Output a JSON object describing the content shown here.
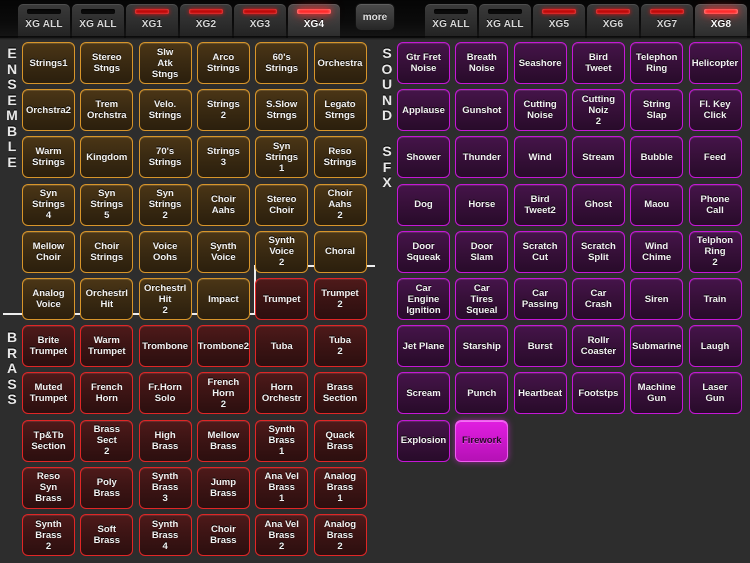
{
  "tabbar": {
    "more_label": "more",
    "left_tabs": [
      {
        "label": "XG ALL",
        "led": "off",
        "active": false
      },
      {
        "label": "XG ALL",
        "led": "off",
        "active": false
      },
      {
        "label": "XG1",
        "led": "on",
        "active": false
      },
      {
        "label": "XG2",
        "led": "on",
        "active": false
      },
      {
        "label": "XG3",
        "led": "on",
        "active": false
      },
      {
        "label": "XG4",
        "led": "on",
        "active": true
      }
    ],
    "right_tabs": [
      {
        "label": "XG ALL",
        "led": "off",
        "active": false
      },
      {
        "label": "XG ALL",
        "led": "off",
        "active": false
      },
      {
        "label": "XG5",
        "led": "on",
        "active": false
      },
      {
        "label": "XG6",
        "led": "on",
        "active": false
      },
      {
        "label": "XG7",
        "led": "on",
        "active": false
      },
      {
        "label": "XG8",
        "led": "on",
        "active": true
      }
    ]
  },
  "colors": {
    "ensemble_border": "#d8952a",
    "brass_border": "#e02626",
    "sfx_border": "#c517d6",
    "selected_fill": "#cc17cc",
    "led_active": "#ff1c1c",
    "background": "#2d2d2d"
  },
  "left_panel": {
    "sections": [
      {
        "name": "ENSEMBLE",
        "letters": [
          "E",
          "N",
          "S",
          "E",
          "M",
          "B",
          "L",
          "E"
        ]
      },
      {
        "name": "BRASS",
        "letters": [
          "B",
          "R",
          "A",
          "S",
          "S"
        ]
      }
    ],
    "buttons": [
      {
        "label": "Strings1",
        "kind": "ens",
        "row": 0,
        "col": 0
      },
      {
        "label": "Stereo\nStngs",
        "kind": "ens",
        "row": 0,
        "col": 1
      },
      {
        "label": "Slw\nAtk\nStngs",
        "kind": "ens",
        "row": 0,
        "col": 2
      },
      {
        "label": "Arco\nStrings",
        "kind": "ens",
        "row": 0,
        "col": 3
      },
      {
        "label": "60's\nStrings",
        "kind": "ens",
        "row": 0,
        "col": 4
      },
      {
        "label": "Orchestra",
        "kind": "ens",
        "row": 0,
        "col": 5
      },
      {
        "label": "Orchstra2",
        "kind": "ens",
        "row": 1,
        "col": 0
      },
      {
        "label": "Trem\nOrchstra",
        "kind": "ens",
        "row": 1,
        "col": 1
      },
      {
        "label": "Velo.\nStrings",
        "kind": "ens",
        "row": 1,
        "col": 2
      },
      {
        "label": "Strings\n2",
        "kind": "ens",
        "row": 1,
        "col": 3
      },
      {
        "label": "S.Slow\nStrngs",
        "kind": "ens",
        "row": 1,
        "col": 4
      },
      {
        "label": "Legato\nStrngs",
        "kind": "ens",
        "row": 1,
        "col": 5
      },
      {
        "label": "Warm\nStrings",
        "kind": "ens",
        "row": 2,
        "col": 0
      },
      {
        "label": "Kingdom",
        "kind": "ens",
        "row": 2,
        "col": 1
      },
      {
        "label": "70's\nStrings",
        "kind": "ens",
        "row": 2,
        "col": 2
      },
      {
        "label": "Strings\n3",
        "kind": "ens",
        "row": 2,
        "col": 3
      },
      {
        "label": "Syn\nStrings\n1",
        "kind": "ens",
        "row": 2,
        "col": 4
      },
      {
        "label": "Reso\nStrings",
        "kind": "ens",
        "row": 2,
        "col": 5
      },
      {
        "label": "Syn\nStrings\n4",
        "kind": "ens",
        "row": 3,
        "col": 0
      },
      {
        "label": "Syn\nStrings\n5",
        "kind": "ens",
        "row": 3,
        "col": 1
      },
      {
        "label": "Syn\nStrings\n2",
        "kind": "ens",
        "row": 3,
        "col": 2
      },
      {
        "label": "Choir\nAahs",
        "kind": "ens",
        "row": 3,
        "col": 3
      },
      {
        "label": "Stereo\nChoir",
        "kind": "ens",
        "row": 3,
        "col": 4
      },
      {
        "label": "Choir\nAahs\n2",
        "kind": "ens",
        "row": 3,
        "col": 5
      },
      {
        "label": "Mellow\nChoir",
        "kind": "ens",
        "row": 4,
        "col": 0
      },
      {
        "label": "Choir\nStrings",
        "kind": "ens",
        "row": 4,
        "col": 1
      },
      {
        "label": "Voice\nOohs",
        "kind": "ens",
        "row": 4,
        "col": 2
      },
      {
        "label": "Synth\nVoice",
        "kind": "ens",
        "row": 4,
        "col": 3
      },
      {
        "label": "Synth\nVoice\n2",
        "kind": "ens",
        "row": 4,
        "col": 4
      },
      {
        "label": "Choral",
        "kind": "ens",
        "row": 4,
        "col": 5
      },
      {
        "label": "Analog\nVoice",
        "kind": "ens",
        "row": 5,
        "col": 0
      },
      {
        "label": "Orchestrl\nHit",
        "kind": "ens",
        "row": 5,
        "col": 1
      },
      {
        "label": "Orchestrl\nHit\n2",
        "kind": "ens",
        "row": 5,
        "col": 2
      },
      {
        "label": "Impact",
        "kind": "ens",
        "row": 5,
        "col": 3
      },
      {
        "label": "Trumpet",
        "kind": "brs",
        "row": 5,
        "col": 4
      },
      {
        "label": "Trumpet\n2",
        "kind": "brs",
        "row": 5,
        "col": 5
      },
      {
        "label": "Brite\nTrumpet",
        "kind": "brs",
        "row": 6,
        "col": 0
      },
      {
        "label": "Warm\nTrumpet",
        "kind": "brs",
        "row": 6,
        "col": 1
      },
      {
        "label": "Trombone",
        "kind": "brs",
        "row": 6,
        "col": 2
      },
      {
        "label": "Trombone2",
        "kind": "brs",
        "row": 6,
        "col": 3
      },
      {
        "label": "Tuba",
        "kind": "brs",
        "row": 6,
        "col": 4
      },
      {
        "label": "Tuba\n2",
        "kind": "brs",
        "row": 6,
        "col": 5
      },
      {
        "label": "Muted\nTrumpet",
        "kind": "brs",
        "row": 7,
        "col": 0
      },
      {
        "label": "French\nHorn",
        "kind": "brs",
        "row": 7,
        "col": 1
      },
      {
        "label": "Fr.Horn\nSolo",
        "kind": "brs",
        "row": 7,
        "col": 2
      },
      {
        "label": "French\nHorn\n2",
        "kind": "brs",
        "row": 7,
        "col": 3
      },
      {
        "label": "Horn\nOrchestr",
        "kind": "brs",
        "row": 7,
        "col": 4
      },
      {
        "label": "Brass\nSection",
        "kind": "brs",
        "row": 7,
        "col": 5
      },
      {
        "label": "Tp&Tb\nSection",
        "kind": "brs",
        "row": 8,
        "col": 0
      },
      {
        "label": "Brass\nSect\n2",
        "kind": "brs",
        "row": 8,
        "col": 1
      },
      {
        "label": "High\nBrass",
        "kind": "brs",
        "row": 8,
        "col": 2
      },
      {
        "label": "Mellow\nBrass",
        "kind": "brs",
        "row": 8,
        "col": 3
      },
      {
        "label": "Synth\nBrass\n1",
        "kind": "brs",
        "row": 8,
        "col": 4
      },
      {
        "label": "Quack\nBrass",
        "kind": "brs",
        "row": 8,
        "col": 5
      },
      {
        "label": "Reso\nSyn\nBrass",
        "kind": "brs",
        "row": 9,
        "col": 0
      },
      {
        "label": "Poly\nBrass",
        "kind": "brs",
        "row": 9,
        "col": 1
      },
      {
        "label": "Synth\nBrass\n3",
        "kind": "brs",
        "row": 9,
        "col": 2
      },
      {
        "label": "Jump\nBrass",
        "kind": "brs",
        "row": 9,
        "col": 3
      },
      {
        "label": "Ana Vel\nBrass\n1",
        "kind": "brs",
        "row": 9,
        "col": 4
      },
      {
        "label": "Analog\nBrass\n1",
        "kind": "brs",
        "row": 9,
        "col": 5
      },
      {
        "label": "Synth\nBrass\n2",
        "kind": "brs",
        "row": 10,
        "col": 0
      },
      {
        "label": "Soft\nBrass",
        "kind": "brs",
        "row": 10,
        "col": 1
      },
      {
        "label": "Synth\nBrass\n4",
        "kind": "brs",
        "row": 10,
        "col": 2
      },
      {
        "label": "Choir\nBrass",
        "kind": "brs",
        "row": 10,
        "col": 3
      },
      {
        "label": "Ana Vel\nBrass\n2",
        "kind": "brs",
        "row": 10,
        "col": 4
      },
      {
        "label": "Analog\nBrass\n2",
        "kind": "brs",
        "row": 10,
        "col": 5
      }
    ]
  },
  "right_panel": {
    "sections": [
      {
        "name": "SOUND",
        "letters": [
          "S",
          "O",
          "U",
          "N",
          "D"
        ]
      },
      {
        "name": "SFX",
        "letters": [
          "S",
          "F",
          "X"
        ]
      }
    ],
    "buttons": [
      {
        "label": "Gtr Fret\nNoise",
        "kind": "sfx",
        "row": 0,
        "col": 0
      },
      {
        "label": "Breath\nNoise",
        "kind": "sfx",
        "row": 0,
        "col": 1
      },
      {
        "label": "Seashore",
        "kind": "sfx",
        "row": 0,
        "col": 2
      },
      {
        "label": "Bird\nTweet",
        "kind": "sfx",
        "row": 0,
        "col": 3
      },
      {
        "label": "Telephon\nRing",
        "kind": "sfx",
        "row": 0,
        "col": 4
      },
      {
        "label": "Helicopter",
        "kind": "sfx",
        "row": 0,
        "col": 5
      },
      {
        "label": "Applause",
        "kind": "sfx",
        "row": 1,
        "col": 0
      },
      {
        "label": "Gunshot",
        "kind": "sfx",
        "row": 1,
        "col": 1
      },
      {
        "label": "Cutting\nNoise",
        "kind": "sfx",
        "row": 1,
        "col": 2
      },
      {
        "label": "Cutting\nNoiz\n2",
        "kind": "sfx",
        "row": 1,
        "col": 3
      },
      {
        "label": "String\nSlap",
        "kind": "sfx",
        "row": 1,
        "col": 4
      },
      {
        "label": "Fl. Key\nClick",
        "kind": "sfx",
        "row": 1,
        "col": 5
      },
      {
        "label": "Shower",
        "kind": "sfx",
        "row": 2,
        "col": 0
      },
      {
        "label": "Thunder",
        "kind": "sfx",
        "row": 2,
        "col": 1
      },
      {
        "label": "Wind",
        "kind": "sfx",
        "row": 2,
        "col": 2
      },
      {
        "label": "Stream",
        "kind": "sfx",
        "row": 2,
        "col": 3
      },
      {
        "label": "Bubble",
        "kind": "sfx",
        "row": 2,
        "col": 4
      },
      {
        "label": "Feed",
        "kind": "sfx",
        "row": 2,
        "col": 5
      },
      {
        "label": "Dog",
        "kind": "sfx",
        "row": 3,
        "col": 0
      },
      {
        "label": "Horse",
        "kind": "sfx",
        "row": 3,
        "col": 1
      },
      {
        "label": "Bird\nTweet2",
        "kind": "sfx",
        "row": 3,
        "col": 2
      },
      {
        "label": "Ghost",
        "kind": "sfx",
        "row": 3,
        "col": 3
      },
      {
        "label": "Maou",
        "kind": "sfx",
        "row": 3,
        "col": 4
      },
      {
        "label": "Phone\nCall",
        "kind": "sfx",
        "row": 3,
        "col": 5
      },
      {
        "label": "Door\nSqueak",
        "kind": "sfx",
        "row": 4,
        "col": 0
      },
      {
        "label": "Door\nSlam",
        "kind": "sfx",
        "row": 4,
        "col": 1
      },
      {
        "label": "Scratch\nCut",
        "kind": "sfx",
        "row": 4,
        "col": 2
      },
      {
        "label": "Scratch\nSplit",
        "kind": "sfx",
        "row": 4,
        "col": 3
      },
      {
        "label": "Wind\nChime",
        "kind": "sfx",
        "row": 4,
        "col": 4
      },
      {
        "label": "Telphon\nRing\n2",
        "kind": "sfx",
        "row": 4,
        "col": 5
      },
      {
        "label": "Car\nEngine\nIgnition",
        "kind": "sfx",
        "row": 5,
        "col": 0
      },
      {
        "label": "Car\nTires\nSqueal",
        "kind": "sfx",
        "row": 5,
        "col": 1
      },
      {
        "label": "Car\nPassing",
        "kind": "sfx",
        "row": 5,
        "col": 2
      },
      {
        "label": "Car\nCrash",
        "kind": "sfx",
        "row": 5,
        "col": 3
      },
      {
        "label": "Siren",
        "kind": "sfx",
        "row": 5,
        "col": 4
      },
      {
        "label": "Train",
        "kind": "sfx",
        "row": 5,
        "col": 5
      },
      {
        "label": "Jet Plane",
        "kind": "sfx",
        "row": 6,
        "col": 0
      },
      {
        "label": "Starship",
        "kind": "sfx",
        "row": 6,
        "col": 1
      },
      {
        "label": "Burst",
        "kind": "sfx",
        "row": 6,
        "col": 2
      },
      {
        "label": "Rollr\nCoaster",
        "kind": "sfx",
        "row": 6,
        "col": 3
      },
      {
        "label": "Submarine",
        "kind": "sfx",
        "row": 6,
        "col": 4
      },
      {
        "label": "Laugh",
        "kind": "sfx",
        "row": 6,
        "col": 5
      },
      {
        "label": "Scream",
        "kind": "sfx",
        "row": 7,
        "col": 0
      },
      {
        "label": "Punch",
        "kind": "sfx",
        "row": 7,
        "col": 1
      },
      {
        "label": "Heartbeat",
        "kind": "sfx",
        "row": 7,
        "col": 2
      },
      {
        "label": "Footstps",
        "kind": "sfx",
        "row": 7,
        "col": 3
      },
      {
        "label": "Machine\nGun",
        "kind": "sfx",
        "row": 7,
        "col": 4
      },
      {
        "label": "Laser\nGun",
        "kind": "sfx",
        "row": 7,
        "col": 5
      },
      {
        "label": "Explosion",
        "kind": "sfx",
        "row": 8,
        "col": 0
      },
      {
        "label": "Firework",
        "kind": "sfx",
        "row": 8,
        "col": 1,
        "selected": true
      }
    ]
  }
}
